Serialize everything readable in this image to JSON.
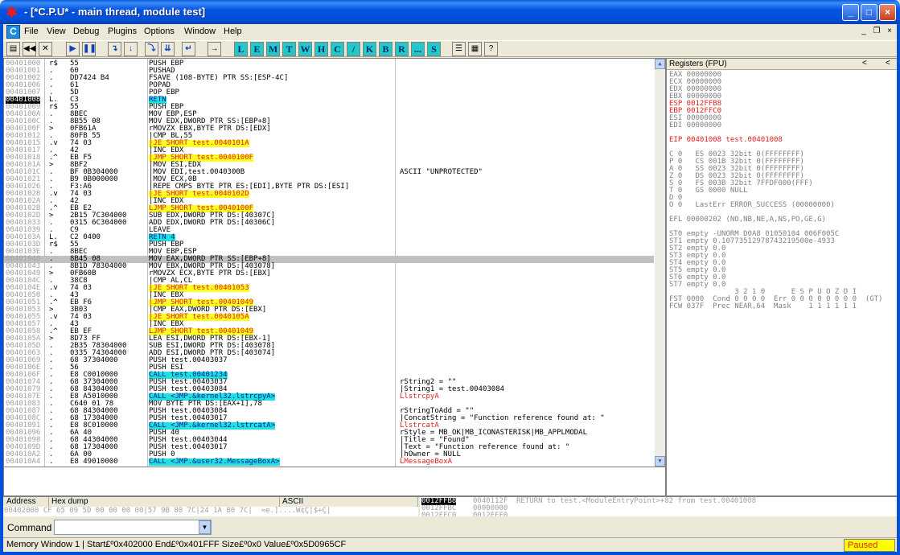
{
  "window": {
    "title": "- [*C.P.U* - main thread, module test]",
    "min": "_",
    "max": "□",
    "close": "×"
  },
  "menu": {
    "icon": "C",
    "items": [
      "File",
      "View",
      "Debug",
      "Plugins",
      "Options",
      "Window",
      "Help"
    ],
    "mdi_min": "_",
    "mdi_restore": "❐",
    "mdi_close": "×"
  },
  "toolbar": {
    "buttons": [
      {
        "icon": "open-icon",
        "glyph": "▤"
      },
      {
        "icon": "rewind-icon",
        "glyph": "◀◀"
      },
      {
        "icon": "close-icon",
        "glyph": "✕"
      },
      {
        "icon": "run-icon",
        "glyph": "▶"
      },
      {
        "icon": "pause-icon",
        "glyph": "❚❚"
      },
      {
        "icon": "step-into-icon",
        "glyph": "↴"
      },
      {
        "icon": "step-over-icon",
        "glyph": "↓"
      },
      {
        "icon": "trace-into-icon",
        "glyph": "⤵"
      },
      {
        "icon": "trace-over-icon",
        "glyph": "⇊"
      },
      {
        "icon": "execute-till-return-icon",
        "glyph": "↵"
      },
      {
        "icon": "goto-icon",
        "glyph": "→"
      }
    ],
    "letters": [
      "L",
      "E",
      "M",
      "T",
      "W",
      "H",
      "C",
      "/",
      "K",
      "B",
      "R",
      "...",
      "S"
    ],
    "tail": [
      {
        "icon": "list-icon",
        "glyph": "☰"
      },
      {
        "icon": "grid-icon",
        "glyph": "▦"
      },
      {
        "icon": "help-icon",
        "glyph": "?"
      }
    ]
  },
  "disasm": {
    "rows": [
      {
        "addr": "00401000",
        "mk": "r$",
        "hex": "55",
        "ins": "PUSH EBP",
        "cm": ""
      },
      {
        "addr": "00401001",
        "mk": ".",
        "hex": "60",
        "ins": "PUSHAD",
        "cm": ""
      },
      {
        "addr": "00401002",
        "mk": ".",
        "hex": "DD7424 B4",
        "ins": "FSAVE (108-BYTE) PTR SS:[ESP-4C]",
        "cm": ""
      },
      {
        "addr": "00401006",
        "mk": ".",
        "hex": "61",
        "ins": "POPAD",
        "cm": ""
      },
      {
        "addr": "00401007",
        "mk": ".",
        "hex": "5D",
        "ins": "POP EBP",
        "cm": ""
      },
      {
        "addr": "00401008",
        "mk": "L.",
        "hex": "C3",
        "ins": "RETN",
        "cm": "",
        "hl": "c"
      },
      {
        "addr": "00401009",
        "mk": "r$",
        "hex": "55",
        "ins": "PUSH EBP",
        "cm": ""
      },
      {
        "addr": "0040100A",
        "mk": ".",
        "hex": "8BEC",
        "ins": "MOV EBP,ESP",
        "cm": ""
      },
      {
        "addr": "0040100C",
        "mk": ".",
        "hex": "8B55 08",
        "ins": "MOV EDX,DWORD PTR SS:[EBP+8]",
        "cm": ""
      },
      {
        "addr": "0040100F",
        "mk": ">",
        "hex": "0FB61A",
        "ins": "rMOVZX EBX,BYTE PTR DS:[EDX]",
        "cm": ""
      },
      {
        "addr": "00401012",
        "mk": ".",
        "hex": "80FB 55",
        "ins": "|CMP BL,55",
        "cm": ""
      },
      {
        "addr": "00401015",
        "mk": ".v",
        "hex": "74 03",
        "ins": "|JE SHORT test.0040101A",
        "cm": "",
        "hl": "y"
      },
      {
        "addr": "00401017",
        "mk": ".",
        "hex": "42",
        "ins": "|INC EDX",
        "cm": ""
      },
      {
        "addr": "00401018",
        "mk": ".^",
        "hex": "EB F5",
        "ins": "|JMP SHORT test.0040100F",
        "cm": "",
        "hl": "y2"
      },
      {
        "addr": "0040101A",
        "mk": ">",
        "hex": "8BF2",
        "ins": "|MOV ESI,EDX",
        "cm": ""
      },
      {
        "addr": "0040101C",
        "mk": ".",
        "hex": "BF 0B304000",
        "ins": "|MOV EDI,test.0040300B",
        "cm": "ASCII \"UNPROTECTED\""
      },
      {
        "addr": "00401021",
        "mk": ".",
        "hex": "B9 0B000000",
        "ins": "|MOV ECX,0B",
        "cm": ""
      },
      {
        "addr": "00401026",
        "mk": ".",
        "hex": "F3:A6",
        "ins": "|REPE CMPS BYTE PTR ES:[EDI],BYTE PTR DS:[ESI]",
        "cm": ""
      },
      {
        "addr": "00401028",
        "mk": ".v",
        "hex": "74 03",
        "ins": "|JE SHORT test.0040102D",
        "cm": "",
        "hl": "y"
      },
      {
        "addr": "0040102A",
        "mk": ".",
        "hex": "42",
        "ins": "|INC EDX",
        "cm": ""
      },
      {
        "addr": "0040102B",
        "mk": ".^",
        "hex": "EB E2",
        "ins": "LJMP SHORT test.0040100F",
        "cm": "",
        "hl": "y2"
      },
      {
        "addr": "0040102D",
        "mk": ">",
        "hex": "2B15 7C304000",
        "ins": "SUB EDX,DWORD PTR DS:[40307C]",
        "cm": ""
      },
      {
        "addr": "00401033",
        "mk": ".",
        "hex": "0315 6C304000",
        "ins": "ADD EDX,DWORD PTR DS:[40306C]",
        "cm": ""
      },
      {
        "addr": "00401039",
        "mk": ".",
        "hex": "C9",
        "ins": "LEAVE",
        "cm": ""
      },
      {
        "addr": "0040103A",
        "mk": "L.",
        "hex": "C2 0400",
        "ins": "RETN 4",
        "cm": "",
        "hl": "c"
      },
      {
        "addr": "0040103D",
        "mk": "r$",
        "hex": "55",
        "ins": "PUSH EBP",
        "cm": ""
      },
      {
        "addr": "0040103E",
        "mk": ".",
        "hex": "8BEC",
        "ins": "MOV EBP,ESP",
        "cm": ""
      },
      {
        "addr": "00401040",
        "mk": ".",
        "hex": "8B45 08",
        "ins": "MOV EAX,DWORD PTR SS:[EBP+8]",
        "cm": "",
        "sel": true
      },
      {
        "addr": "00401043",
        "mk": ".",
        "hex": "8B1D 78304000",
        "ins": "MOV EBX,DWORD PTR DS:[403078]",
        "cm": ""
      },
      {
        "addr": "00401049",
        "mk": ">",
        "hex": "0FB60B",
        "ins": "rMOVZX ECX,BYTE PTR DS:[EBX]",
        "cm": ""
      },
      {
        "addr": "0040104C",
        "mk": ".",
        "hex": "38C8",
        "ins": "|CMP AL,CL",
        "cm": ""
      },
      {
        "addr": "0040104E",
        "mk": ".v",
        "hex": "74 03",
        "ins": "|JE SHORT test.00401053",
        "cm": "",
        "hl": "y"
      },
      {
        "addr": "00401050",
        "mk": ".",
        "hex": "43",
        "ins": "|INC EBX",
        "cm": ""
      },
      {
        "addr": "00401051",
        "mk": ".^",
        "hex": "EB F6",
        "ins": "|JMP SHORT test.00401049",
        "cm": "",
        "hl": "y2"
      },
      {
        "addr": "00401053",
        "mk": ">",
        "hex": "3B03",
        "ins": "|CMP EAX,DWORD PTR DS:[EBX]",
        "cm": ""
      },
      {
        "addr": "00401055",
        "mk": ".v",
        "hex": "74 03",
        "ins": "|JE SHORT test.0040105A",
        "cm": "",
        "hl": "y"
      },
      {
        "addr": "00401057",
        "mk": ".",
        "hex": "43",
        "ins": "|INC EBX",
        "cm": ""
      },
      {
        "addr": "00401058",
        "mk": ".^",
        "hex": "EB EF",
        "ins": "LJMP SHORT test.00401049",
        "cm": "",
        "hl": "y2"
      },
      {
        "addr": "0040105A",
        "mk": ">",
        "hex": "8D73 FF",
        "ins": "LEA ESI,DWORD PTR DS:[EBX-1]",
        "cm": ""
      },
      {
        "addr": "0040105D",
        "mk": ".",
        "hex": "2B35 78304000",
        "ins": "SUB ESI,DWORD PTR DS:[403078]",
        "cm": ""
      },
      {
        "addr": "00401063",
        "mk": ".",
        "hex": "0335 74304000",
        "ins": "ADD ESI,DWORD PTR DS:[403074]",
        "cm": ""
      },
      {
        "addr": "00401069",
        "mk": ".",
        "hex": "68 37304000",
        "ins": "PUSH test.00403037",
        "cm": ""
      },
      {
        "addr": "0040106E",
        "mk": ".",
        "hex": "56",
        "ins": "PUSH ESI",
        "cm": ""
      },
      {
        "addr": "0040106F",
        "mk": ".",
        "hex": "E8 C0010000",
        "ins": "CALL test.00401234",
        "cm": "",
        "hl": "c"
      },
      {
        "addr": "00401074",
        "mk": ".",
        "hex": "68 37304000",
        "ins": "PUSH test.00403037",
        "cm": "rString2 = \"\""
      },
      {
        "addr": "00401079",
        "mk": ".",
        "hex": "68 84304000",
        "ins": "PUSH test.00403084",
        "cm": "|String1 = test.00403084"
      },
      {
        "addr": "0040107E",
        "mk": ".",
        "hex": "E8 A5010000",
        "ins": "CALL <JMP.&kernel32.lstrcpyA>",
        "cm": "LlstrcpyA",
        "hl": "c",
        "cmc": "red"
      },
      {
        "addr": "00401083",
        "mk": ".",
        "hex": "C640 01 78",
        "ins": "MOV BYTE PTR DS:[EAX+1],78",
        "cm": ""
      },
      {
        "addr": "00401087",
        "mk": ".",
        "hex": "68 84304000",
        "ins": "PUSH test.00403084",
        "cm": "rStringToAdd = \"\""
      },
      {
        "addr": "0040108C",
        "mk": ".",
        "hex": "68 17304000",
        "ins": "PUSH test.00403017",
        "cm": "|ConcatString = \"Function reference found at: \""
      },
      {
        "addr": "00401091",
        "mk": ".",
        "hex": "E8 8C010000",
        "ins": "CALL <JMP.&kernel32.lstrcatA>",
        "cm": "LlstrcatA",
        "hl": "c",
        "cmc": "red"
      },
      {
        "addr": "00401096",
        "mk": ".",
        "hex": "6A 40",
        "ins": "PUSH 40",
        "cm": "rStyle = MB_OK|MB_ICONASTERISK|MB_APPLMODAL"
      },
      {
        "addr": "00401098",
        "mk": ".",
        "hex": "68 44304000",
        "ins": "PUSH test.00403044",
        "cm": "|Title = \"Found\""
      },
      {
        "addr": "0040109D",
        "mk": ".",
        "hex": "68 17304000",
        "ins": "PUSH test.00403017",
        "cm": "|Text = \"Function reference found at: \""
      },
      {
        "addr": "004010A2",
        "mk": ".",
        "hex": "6A 00",
        "ins": "PUSH 0",
        "cm": "|hOwner = NULL"
      },
      {
        "addr": "004010A4",
        "mk": ".",
        "hex": "E8 49010000",
        "ins": "CALL <JMP.&user32.MessageBoxA>",
        "cm": "LMessageBoxA",
        "hl": "c",
        "cmc": "red"
      }
    ]
  },
  "registers": {
    "header": "Registers (FPU)",
    "nav_left": "<",
    "nav_right": "<",
    "lines": [
      {
        "t": "EAX 00000000"
      },
      {
        "t": "ECX 00000000"
      },
      {
        "t": "EDX 00000000"
      },
      {
        "t": "EBX 00000000"
      },
      {
        "t": "ESP 0012FFB8",
        "c": "red"
      },
      {
        "t": "EBP 0012FFC0",
        "c": "red"
      },
      {
        "t": "ESI 00000000"
      },
      {
        "t": "EDI 00000000"
      },
      {
        "t": ""
      },
      {
        "t": "EIP 00401008 test.00401008",
        "c": "red"
      },
      {
        "t": ""
      },
      {
        "t": "C 0   ES 0023 32bit 0(FFFFFFFF)"
      },
      {
        "t": "P 0   CS 001B 32bit 0(FFFFFFFF)"
      },
      {
        "t": "A 0   SS 0023 32bit 0(FFFFFFFF)"
      },
      {
        "t": "Z 0   DS 0023 32bit 0(FFFFFFFF)"
      },
      {
        "t": "S 0   FS 003B 32bit 7FFDF000(FFF)"
      },
      {
        "t": "T 0   GS 0000 NULL"
      },
      {
        "t": "D 0"
      },
      {
        "t": "O 0   LastErr ERROR_SUCCESS (00000000)"
      },
      {
        "t": ""
      },
      {
        "t": "EFL 00000202 (NO,NB,NE,A,NS,PO,GE,G)"
      },
      {
        "t": ""
      },
      {
        "t": "ST0 empty -UNORM D0A8 01050104 006F005C"
      },
      {
        "t": "ST1 empty 0.10773512978743219500e-4933"
      },
      {
        "t": "ST2 empty 0.0"
      },
      {
        "t": "ST3 empty 0.0"
      },
      {
        "t": "ST4 empty 0.0"
      },
      {
        "t": "ST5 empty 0.0"
      },
      {
        "t": "ST6 empty 0.0"
      },
      {
        "t": "ST7 empty 0.0"
      },
      {
        "t": "               3 2 1 0      E S P U O Z D I"
      },
      {
        "t": "FST 0000  Cond 0 0 0 0  Err 0 0 0 0 0 0 0 0  (GT)"
      },
      {
        "t": "FCW 037F  Prec NEAR,64  Mask    1 1 1 1 1 1"
      }
    ]
  },
  "dump": {
    "col_address": "Address",
    "col_hex": "Hex dump",
    "col_ascii": "ASCII",
    "row": "00402000 CF 65 09 5D 00 00 00 00|57 9B 80 7C|24 1A 80 7C|  =e.]....W¢Ç|$+Ç|"
  },
  "stack": {
    "rows": [
      {
        "addr": "0012FFB8",
        "val": "0040112F",
        "cm": "RETURN to test.<ModuleEntryPoint>+82 from test.00401008"
      },
      {
        "addr": "0012FFBC",
        "val": "00000000",
        "cm": ""
      },
      {
        "addr": "0012FFC0",
        "val": "0012FFF0",
        "cm": ""
      }
    ]
  },
  "command": {
    "label": "Command",
    "value": "",
    "drop": "▼"
  },
  "status": {
    "text": "Memory Window 1 | Start£º0x402000  End£º0x401FFF  Size£º0x0 Value£º0x5D0965CF",
    "state": "Paused"
  }
}
